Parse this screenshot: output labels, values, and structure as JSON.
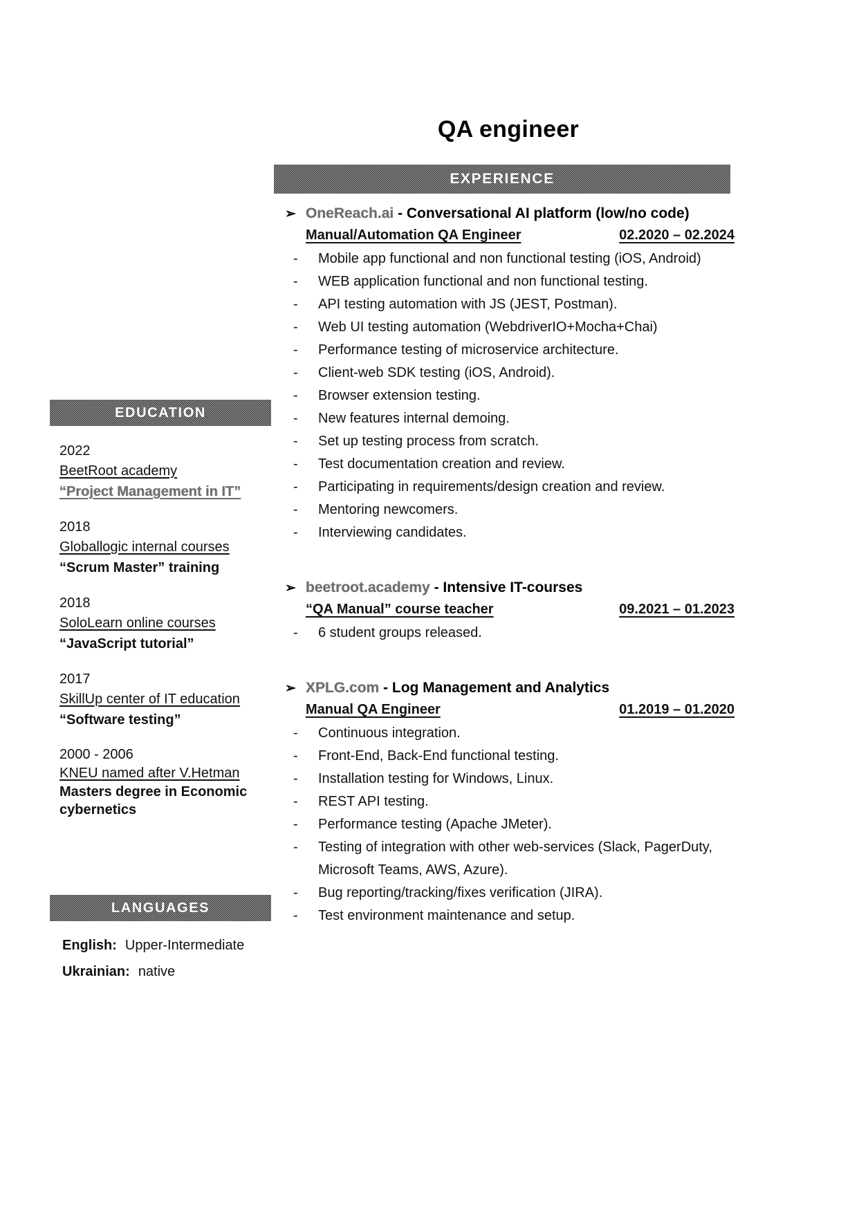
{
  "document": {
    "title": "QA engineer"
  },
  "sections": {
    "experience_label": "EXPERIENCE",
    "education_label": "EDUCATION",
    "languages_label": "LANGUAGES"
  },
  "icons": {
    "arrow_bullet": "➢",
    "dash_bullet": "-"
  },
  "education": [
    {
      "year": "2022",
      "school": "BeetRoot academy",
      "program": "“Project Management in IT”",
      "program_is_link": true
    },
    {
      "year": "2018",
      "school": "Globallogic internal courses",
      "program": "“Scrum Master” training",
      "program_is_link": false
    },
    {
      "year": "2018",
      "school": "SoloLearn online courses",
      "program": "“JavaScript tutorial”",
      "program_is_link": false
    },
    {
      "year": "2017",
      "school": "SkillUp center of IT education",
      "program": "“Software testing”",
      "program_is_link": false
    },
    {
      "year": "2000 - 2006",
      "school": "KNEU named after V.Hetman",
      "program": "Masters degree in Economic cybernetics",
      "program_is_link": false
    }
  ],
  "languages": [
    {
      "name": "English:",
      "value": "Upper-Intermediate"
    },
    {
      "name": "Ukrainian:",
      "value": "native"
    }
  ],
  "experience": [
    {
      "company": "OneReach.ai",
      "company_description": " - Conversational AI platform (low/no code)",
      "role": "Manual/Automation QA Engineer",
      "dates": "02.2020 – 02.2024",
      "duties": [
        "Mobile app functional and non functional testing (iOS, Android)",
        "WEB application functional and non functional testing.",
        "API testing automation with JS (JEST, Postman).",
        "Web UI testing automation (WebdriverIO+Mocha+Chai)",
        "Performance testing of microservice architecture.",
        "Client-web SDK testing (iOS, Android).",
        "Browser extension testing.",
        "New features internal demoing.",
        "Set up testing process from scratch.",
        "Test documentation creation and review.",
        "Participating in requirements/design creation and review.",
        "Mentoring newcomers.",
        "Interviewing candidates."
      ]
    },
    {
      "company": "beetroot.academy",
      "company_description": " - Intensive IT-courses",
      "role": "“QA Manual” course teacher ",
      "dates": "09.2021 – 01.2023",
      "duties": [
        "6 student groups released."
      ]
    },
    {
      "company": "XPLG.com",
      "company_description": " - Log Management and Analytics",
      "role": "Manual QA Engineer",
      "dates": "01.2019 – 01.2020",
      "duties": [
        "Continuous integration.",
        "Front-End, Back-End functional testing.",
        "Installation testing for Windows, Linux.",
        "REST API testing.",
        "Performance testing (Apache JMeter).",
        "Testing of integration with other web-services (Slack, PagerDuty, Microsoft Teams, AWS, Azure).",
        "Bug reporting/tracking/fixes verification (JIRA).",
        "Test environment maintenance and setup."
      ]
    }
  ]
}
